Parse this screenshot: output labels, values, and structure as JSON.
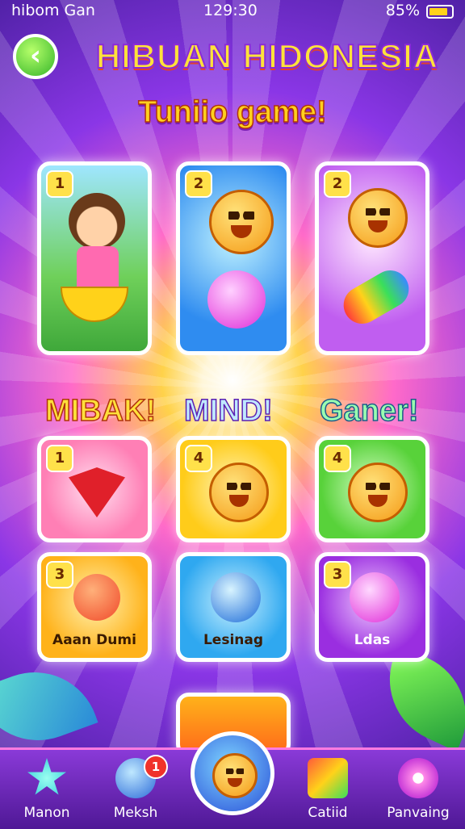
{
  "status_bar": {
    "carrier": "hibom Gan",
    "time": "129:30",
    "battery": "85%",
    "battery_level": 0.85
  },
  "header": {
    "title": "HIBUAN HIDONESIA",
    "subtitle": "Tuniio game!"
  },
  "sections": [
    {
      "label": "MIBAK!",
      "color": "#ffe03a"
    },
    {
      "label": "MIND!",
      "color": "#9ad8ff"
    },
    {
      "label": "Ganer!",
      "color": "#7fff9a"
    }
  ],
  "top_cards": [
    {
      "number": "1",
      "color": "#5fc3ff"
    },
    {
      "number": "2",
      "color": "#2f8cf0"
    },
    {
      "number": "2",
      "color": "#c05ef0"
    }
  ],
  "grid_cards": [
    {
      "number": "1",
      "caption": "",
      "color": "#ff7fb5"
    },
    {
      "number": "4",
      "caption": "",
      "color": "#ffcc1a"
    },
    {
      "number": "4",
      "caption": "",
      "color": "#58d23a"
    },
    {
      "number": "3",
      "caption": "Aaan Dumi",
      "color": "#ffb21a"
    },
    {
      "number": "",
      "caption": "Lesinag",
      "color": "#2fa8f0"
    },
    {
      "number": "3",
      "caption": "Ldas",
      "color": "#9a2ee0"
    }
  ],
  "nav": [
    {
      "label": "Manon",
      "icon": "star-icon",
      "badge": ""
    },
    {
      "label": "Meksh",
      "icon": "gem-icon",
      "badge": "1"
    },
    {
      "label": "",
      "icon": "mascot-icon",
      "badge": ""
    },
    {
      "label": "Catiid",
      "icon": "chest-icon",
      "badge": ""
    },
    {
      "label": "Panvaing",
      "icon": "gear-icon",
      "badge": ""
    }
  ]
}
